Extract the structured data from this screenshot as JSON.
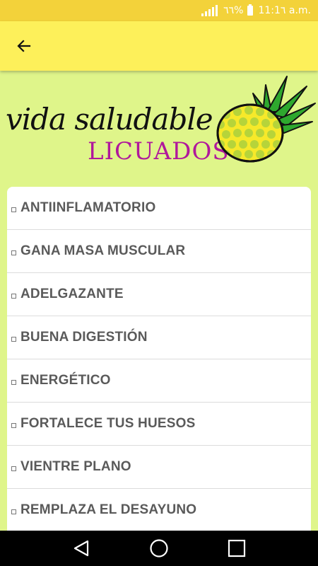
{
  "status_bar": {
    "battery_text": "٦٦%",
    "time_text": "11:1٦ a.m."
  },
  "app_bar": {
    "back_icon": "arrow-left-icon"
  },
  "banner": {
    "title": "vida saludable",
    "subtitle": "LICUADOS",
    "subtitle_color": "#b0189c",
    "illustration": "pineapple"
  },
  "list": {
    "items": [
      {
        "label": "ANTIINFLAMATORIO"
      },
      {
        "label": "GANA MASA MUSCULAR"
      },
      {
        "label": "ADELGAZANTE"
      },
      {
        "label": "BUENA DIGESTIÓN"
      },
      {
        "label": "ENERGÉTICO"
      },
      {
        "label": "FORTALECE TUS HUESOS"
      },
      {
        "label": "VIENTRE PLANO"
      },
      {
        "label": "REMPLAZA EL DESAYUNO"
      }
    ]
  },
  "nav_bar": {
    "icons": [
      "back-triangle-icon",
      "home-circle-icon",
      "recents-square-icon"
    ]
  },
  "colors": {
    "background": "#dff58a",
    "app_bar": "#fdf05a",
    "status_bar": "#f3d23a",
    "item_text": "#5a5a5a"
  }
}
